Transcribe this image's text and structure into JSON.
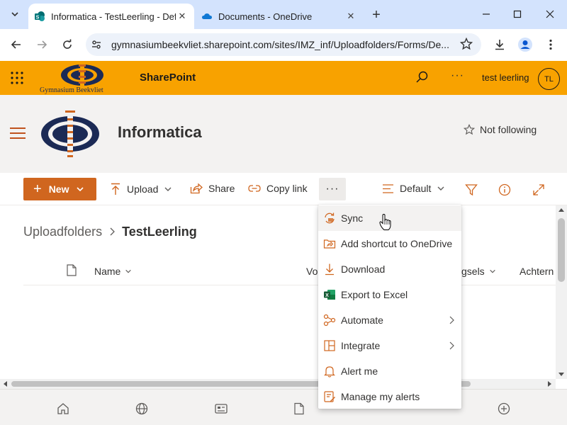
{
  "browser": {
    "tabs": [
      {
        "title": "Informatica - TestLeerling - Defa",
        "active": true
      },
      {
        "title": "Documents - OneDrive",
        "active": false
      }
    ],
    "url": "gymnasiumbeekvliet.sharepoint.com/sites/IMZ_inf/Uploadfolders/Forms/De..."
  },
  "suitebar": {
    "brand_text": "Gymnasium Beekvliet",
    "app_name": "SharePoint",
    "more": "···",
    "user_name": "test leerling",
    "avatar_initials": "TL"
  },
  "site": {
    "title": "Informatica",
    "follow_label": "Not following"
  },
  "commands": {
    "new_label": "New",
    "upload_label": "Upload",
    "share_label": "Share",
    "copy_link_label": "Copy link",
    "more": "···",
    "view_label": "Default"
  },
  "breadcrumb": {
    "root": "Uploadfolders",
    "current": "TestLeerling"
  },
  "columns": {
    "name": "Name",
    "col2_partial": "Vo",
    "col3_partial": "gsels",
    "col4_partial": "Achtern"
  },
  "menu": {
    "items": [
      {
        "label": "Sync",
        "icon": "sync-icon"
      },
      {
        "label": "Add shortcut to OneDrive",
        "icon": "shortcut-icon"
      },
      {
        "label": "Download",
        "icon": "download-icon"
      },
      {
        "label": "Export to Excel",
        "icon": "excel-icon"
      },
      {
        "label": "Automate",
        "icon": "automate-icon"
      },
      {
        "label": "Integrate",
        "icon": "integrate-icon"
      },
      {
        "label": "Alert me",
        "icon": "bell-icon"
      },
      {
        "label": "Manage my alerts",
        "icon": "manage-alerts-icon"
      }
    ]
  },
  "colors": {
    "suitebar": "#f8a200",
    "accent": "#d0661f",
    "header_bg": "#f3f2f1",
    "logo_navy": "#1b2a55"
  }
}
